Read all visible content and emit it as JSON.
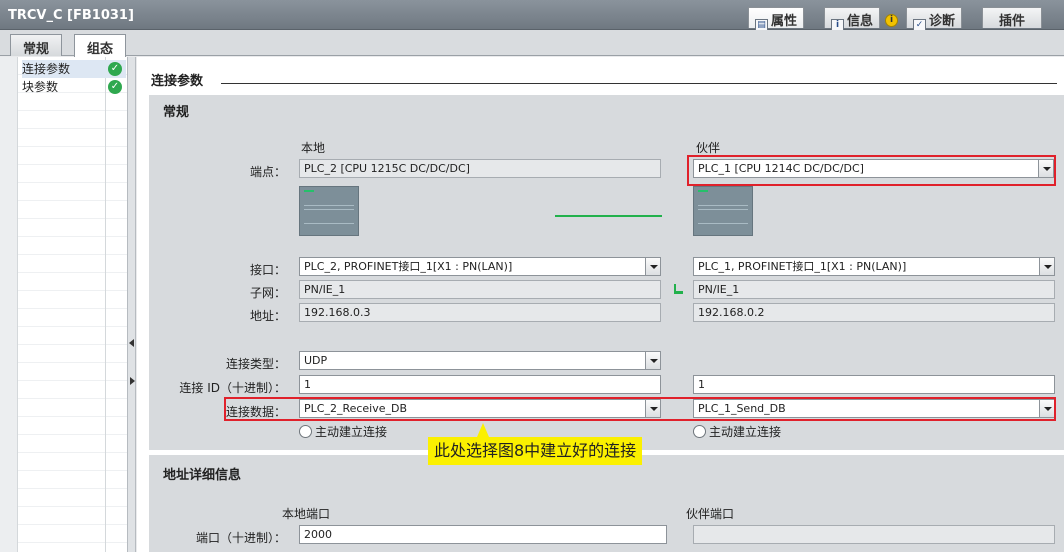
{
  "window": {
    "title": "TRCV_C [FB1031]",
    "tabs": [
      {
        "label": "属性",
        "icon": "properties-icon"
      },
      {
        "label": "信息",
        "icon": "info-icon"
      },
      {
        "label": "诊断",
        "icon": "diagnostics-icon"
      },
      {
        "label": "插件",
        "icon": ""
      }
    ]
  },
  "subtabs": [
    "常规",
    "组态"
  ],
  "nav": {
    "items": [
      {
        "label": "连接参数",
        "status": "ok"
      },
      {
        "label": "块参数",
        "status": "ok"
      }
    ]
  },
  "main": {
    "section_title": "连接参数",
    "general": {
      "title": "常规",
      "local_header": "本地",
      "partner_header": "伙伴",
      "labels": {
        "endpoint": "端点：",
        "interface": "接口：",
        "subnet": "子网：",
        "address": "地址：",
        "conn_type": "连接类型：",
        "conn_id": "连接 ID（十进制）：",
        "conn_data": "连接数据："
      },
      "local": {
        "endpoint": "PLC_2 [CPU 1215C DC/DC/DC]",
        "interface": "PLC_2, PROFINET接口_1[X1 : PN(LAN)]",
        "subnet": "PN/IE_1",
        "address": "192.168.0.3",
        "conn_type": "UDP",
        "conn_id": "1",
        "conn_data": "PLC_2_Receive_DB",
        "active_conn": "主动建立连接"
      },
      "partner": {
        "endpoint": "PLC_1 [CPU 1214C DC/DC/DC]",
        "interface": "PLC_1, PROFINET接口_1[X1 : PN(LAN)]",
        "subnet": "PN/IE_1",
        "address": "192.168.0.2",
        "conn_id": "1",
        "conn_data": "PLC_1_Send_DB",
        "active_conn": "主动建立连接"
      }
    },
    "address_details": {
      "title": "地址详细信息",
      "local_port_header": "本地端口",
      "partner_port_header": "伙伴端口",
      "port_label": "端口（十进制）：",
      "local_port": "2000",
      "partner_port": ""
    },
    "annotation": "此处选择图8中建立好的连接"
  },
  "colors": {
    "highlight": "#e0212b",
    "callout": "#fbf000",
    "ok": "#2fa84f",
    "network": "#22b14c"
  }
}
